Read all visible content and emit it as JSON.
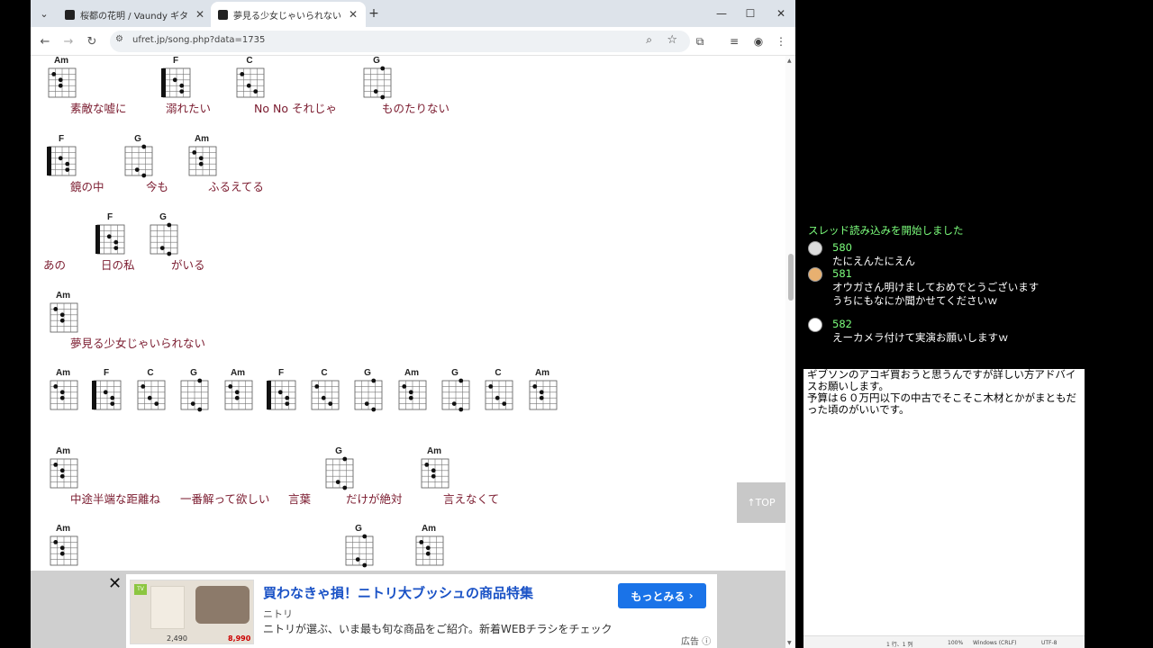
{
  "browser": {
    "tabs": [
      {
        "title": "桜都の花明 / Vaundy ギターコード",
        "active": false
      },
      {
        "title": "夢見る少女じゃいられない / 相川七瀬",
        "active": true
      }
    ],
    "url": "ufret.jp/song.php?data=1735",
    "window_controls": [
      "—",
      "☐",
      "✕"
    ]
  },
  "song": {
    "lines": [
      {
        "chords": [
          {
            "name": "Am",
            "barre": false
          },
          {
            "name": "F",
            "barre": true
          },
          {
            "name": "C",
            "barre": false
          },
          {
            "name": "G",
            "barre": false
          }
        ],
        "lyrics": [
          "素敵な嘘に",
          "溺れたい",
          "No No それじゃ",
          "ものたりない"
        ]
      },
      {
        "chords": [
          {
            "name": "F",
            "barre": true
          },
          {
            "name": "G",
            "barre": false
          },
          {
            "name": "Am",
            "barre": false
          }
        ],
        "lyrics": [
          "鏡の中",
          "今も",
          "ふるえてる"
        ]
      },
      {
        "chords": [
          {
            "name": "F",
            "barre": true
          },
          {
            "name": "G",
            "barre": false
          }
        ],
        "lyrics": [
          "あの",
          "日の私",
          "がいる"
        ]
      },
      {
        "chords": [
          {
            "name": "Am",
            "barre": false
          }
        ],
        "lyrics": [
          "夢見る少女じゃいられない"
        ]
      },
      {
        "chords": [
          {
            "name": "Am",
            "barre": false
          },
          {
            "name": "F",
            "barre": true
          },
          {
            "name": "C",
            "barre": false
          },
          {
            "name": "G",
            "barre": false
          },
          {
            "name": "Am",
            "barre": false
          },
          {
            "name": "F",
            "barre": true
          },
          {
            "name": "C",
            "barre": false
          },
          {
            "name": "G",
            "barre": false
          },
          {
            "name": "Am",
            "barre": false
          },
          {
            "name": "G",
            "barre": false
          },
          {
            "name": "C",
            "barre": false
          },
          {
            "name": "Am",
            "barre": false
          }
        ],
        "lyrics": []
      },
      {
        "chords": [
          {
            "name": "Am",
            "barre": false
          },
          {
            "name": "G",
            "barre": false
          },
          {
            "name": "Am",
            "barre": false
          }
        ],
        "lyrics": [
          "中途半端な距離ね",
          "一番解って欲しい",
          "言葉",
          "だけが絶対",
          "言えなくて"
        ]
      },
      {
        "chords": [
          {
            "name": "Am",
            "barre": false
          },
          {
            "name": "G",
            "barre": false
          },
          {
            "name": "Am",
            "barre": false
          }
        ],
        "lyrics": []
      }
    ],
    "top_button": "↑TOP"
  },
  "ad": {
    "headline": "買わなきゃ損！ニトリ大ブッシュの商品特集",
    "advertiser": "ニトリ",
    "description": "ニトリが選ぶ、いま最も旬な商品をご紹介。新着WEBチラシをチェック",
    "cta": "もっとみる",
    "label": "広告",
    "image_badge": "TV",
    "price_1": "2,490",
    "price_2": "8,990"
  },
  "comments": {
    "status": "スレッド読み込みを開始しました",
    "items": [
      {
        "number": "580",
        "text": "たにえんたにえん"
      },
      {
        "number": "581",
        "text": "オウガさん明けましておめでとうございます\nうちにもなにか聞かせてくださいｗ"
      },
      {
        "number": "582",
        "text": "えーカメラ付けて実演お願いしますｗ"
      }
    ]
  },
  "notepad": {
    "text": "ギブソンのアコギ買おうと思うんですが詳しい方アドバイスお願いします。\n予算は６０万円以下の中古でそこそこ木材とかがまともだった頃のがいいです。",
    "status": {
      "position": "1 行、1 列",
      "zoom": "100%",
      "line_ending": "Windows (CRLF)",
      "encoding": "UTF-8"
    }
  }
}
